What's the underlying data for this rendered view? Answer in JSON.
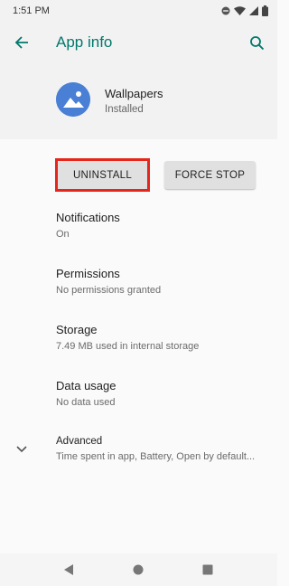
{
  "status_bar": {
    "time": "1:51 PM"
  },
  "header": {
    "title": "App info"
  },
  "app": {
    "name": "Wallpapers",
    "status": "Installed"
  },
  "buttons": {
    "uninstall": "UNINSTALL",
    "force_stop": "FORCE STOP"
  },
  "preferences": [
    {
      "title": "Notifications",
      "summary": "On"
    },
    {
      "title": "Permissions",
      "summary": "No permissions granted"
    },
    {
      "title": "Storage",
      "summary": "7.49 MB used in internal storage"
    },
    {
      "title": "Data usage",
      "summary": "No data used"
    },
    {
      "title": "Advanced",
      "summary": "Time spent in app, Battery, Open by default..."
    }
  ],
  "colors": {
    "accent": "#00796b",
    "highlight": "#e4261c",
    "app_icon": "#4a7fd6"
  },
  "icons": [
    "back-arrow-icon",
    "search-icon",
    "wallpapers-app-icon",
    "chevron-down-icon",
    "nav-back-icon",
    "nav-home-icon",
    "nav-recents-icon"
  ]
}
